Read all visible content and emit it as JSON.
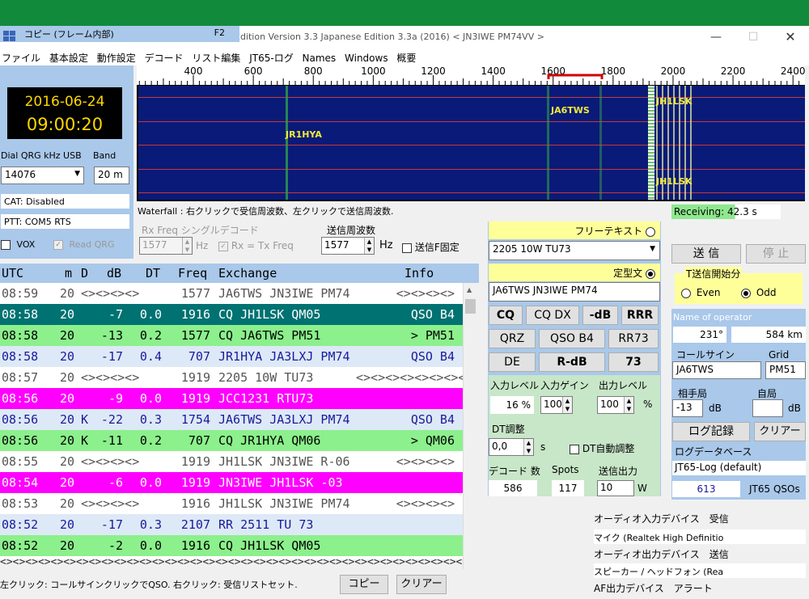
{
  "window": {
    "title": "< JN3IWE PM74VV >",
    "title_prefix": "Edition Version 3.3 Japanese Edition 3.3a (2016)",
    "tooltip_text": "コピー (フレーム内部)",
    "tooltip_key": "F2"
  },
  "menu": [
    "ファイル",
    "基本設定",
    "動作設定",
    "デコード",
    "リスト編集",
    "JT65-ログ",
    "Names",
    "Windows",
    "概要"
  ],
  "clock": {
    "date": "2016-06-24",
    "time": "09:00:20"
  },
  "dial": {
    "label": "Dial QRG kHz USB",
    "value": "14076",
    "band_label": "Band",
    "band_value": "20 m"
  },
  "cat_status": "CAT: Disabled",
  "ptt_status": "PTT: COM5 RTS",
  "vox_label": "VOX",
  "read_qrg_label": "Read QRG",
  "waterfall": {
    "ticks": [
      "400",
      "600",
      "800",
      "1000",
      "1200",
      "1400",
      "1600",
      "1800",
      "2000",
      "2200",
      "2400"
    ],
    "labels": [
      "JA6TWS",
      "JR1HYA",
      "JH1LSK",
      "JH1LSK"
    ],
    "note": "Waterfall : 右クリックで受信周波数、左クリックで送信周波数.",
    "receiving": "Receiving: 42.3 s"
  },
  "rx_single": {
    "label": "Rx Freq シングルデコード",
    "value": "1577",
    "unit": "Hz",
    "rx_eq_tx": "Rx = Tx Freq"
  },
  "tx_freq": {
    "label": "送信周波数",
    "value": "1577",
    "unit": "Hz",
    "fix_label": "送信F固定"
  },
  "decode_header": {
    "utc": "UTC",
    "m": "m",
    "d": "D",
    "db": "dB",
    "dt": "DT",
    "freq": "Freq",
    "exchange": "Exchange",
    "info": "Info"
  },
  "decodes": [
    {
      "utc": "08:59",
      "m": "20",
      "d": "",
      "db": "<><><><>",
      "dt": "",
      "freq": "1577",
      "exchange": "JA6TWS JN3IWE PM74",
      "info": "<><><><>",
      "bg": "#ffffff",
      "fg": "#555555"
    },
    {
      "utc": "08:58",
      "m": "20",
      "d": "",
      "db": "-7",
      "dt": "0.0",
      "freq": "1916",
      "exchange": "CQ JH1LSK QM05",
      "info": "QSO B4",
      "bg": "#007272",
      "fg": "#ffffff"
    },
    {
      "utc": "08:58",
      "m": "20",
      "d": "",
      "db": "-13",
      "dt": "0.2",
      "freq": "1577",
      "exchange": "CQ JA6TWS PM51",
      "info": "> PM51",
      "bg": "#8cf08c",
      "fg": "#000000"
    },
    {
      "utc": "08:58",
      "m": "20",
      "d": "",
      "db": "-17",
      "dt": "0.4",
      "freq": "707",
      "exchange": "JR1HYA JA3LXJ PM74",
      "info": "QSO B4",
      "bg": "#dde9f6",
      "fg": "#1a1a9a"
    },
    {
      "utc": "08:57",
      "m": "20",
      "d": "",
      "db": "<><><><>",
      "dt": "",
      "freq": "1919",
      "exchange": "2205 10W TU73",
      "info": "<><><><><><><><>",
      "bg": "#ffffff",
      "fg": "#555555"
    },
    {
      "utc": "08:56",
      "m": "20",
      "d": "",
      "db": "-9",
      "dt": "0.0",
      "freq": "1919",
      "exchange": "JCC1231 RTU73",
      "info": "",
      "bg": "#ff00ff",
      "fg": "#ffffff"
    },
    {
      "utc": "08:56",
      "m": "20",
      "d": "K",
      "db": "-22",
      "dt": "0.3",
      "freq": "1754",
      "exchange": "JA6TWS JA3LXJ PM74",
      "info": "QSO B4",
      "bg": "#dde9f6",
      "fg": "#1a1a9a"
    },
    {
      "utc": "08:56",
      "m": "20",
      "d": "K",
      "db": "-11",
      "dt": "0.2",
      "freq": "707",
      "exchange": "CQ JR1HYA QM06",
      "info": "> QM06",
      "bg": "#8cf08c",
      "fg": "#000000"
    },
    {
      "utc": "08:55",
      "m": "20",
      "d": "",
      "db": "<><><><>",
      "dt": "",
      "freq": "1919",
      "exchange": "JH1LSK JN3IWE R-06",
      "info": "<><><><>",
      "bg": "#ffffff",
      "fg": "#555555"
    },
    {
      "utc": "08:54",
      "m": "20",
      "d": "",
      "db": "-6",
      "dt": "0.0",
      "freq": "1919",
      "exchange": "JN3IWE JH1LSK -03",
      "info": "",
      "bg": "#ff00ff",
      "fg": "#ffffff"
    },
    {
      "utc": "08:53",
      "m": "20",
      "d": "",
      "db": "<><><><>",
      "dt": "",
      "freq": "1916",
      "exchange": "JH1LSK JN3IWE PM74",
      "info": "<><><><>",
      "bg": "#ffffff",
      "fg": "#555555"
    },
    {
      "utc": "08:52",
      "m": "20",
      "d": "",
      "db": "-17",
      "dt": "0.3",
      "freq": "2107",
      "exchange": "RR 2511 TU 73",
      "info": "",
      "bg": "#dde9f6",
      "fg": "#1a1a9a"
    },
    {
      "utc": "08:52",
      "m": "20",
      "d": "",
      "db": "-2",
      "dt": "0.0",
      "freq": "1916",
      "exchange": "CQ JH1LSK QM05",
      "info": "",
      "bg": "#8cf08c",
      "fg": "#000000"
    }
  ],
  "hscroll_text": "<><><><><><><><><><><><><><><><><><><><><><><><><><><><><><><><><><><><><><><><>",
  "status_hint": "左クリック: コールサインクリックでQSO. 右クリック: 受信リストセット.",
  "copy_button": "コピー",
  "clear_button": "クリアー",
  "macro": {
    "free_text_label": "フリーテキスト",
    "free_text_value": "2205 10W TU73",
    "fixed_label": "定型文",
    "fixed_value": "JA6TWS JN3IWE PM74",
    "buttons": [
      "CQ",
      "CQ DX",
      "-dB",
      "RRR",
      "QRZ",
      "QSO B4",
      "RR73",
      "DE",
      "R-dB",
      "73"
    ],
    "in_level_label": "入力レベル",
    "in_level_value": "16 %",
    "in_gain_label": "入力ゲイン",
    "in_gain_value": "100",
    "out_level_label": "出力レベル",
    "out_level_value": "100",
    "out_unit": "%",
    "dt_adj_label": "DT調整",
    "dt_value": "0,0",
    "dt_unit": "s",
    "dt_auto_label": "DT自動調整",
    "decode_count_label": "デコード 数",
    "decode_count": "586",
    "spots_label": "Spots",
    "spots": "117",
    "tx_power_label": "送信出力",
    "tx_power": "10",
    "tx_power_unit": "W"
  },
  "tx": {
    "send_button": "送 信",
    "stop_button": "停 止",
    "start_label": "T送信開始分",
    "even_label": "Even",
    "odd_label": "Odd"
  },
  "operator": {
    "name_label": "Name of operator",
    "bearing": "231°",
    "distance": "584 km",
    "callsign_label": "コールサイン",
    "grid_label": "Grid",
    "callsign": "JA6TWS",
    "grid": "PM51",
    "their_label": "相手局",
    "their_db": "-13",
    "own_label": "自局",
    "db_unit": "dB",
    "log_button": "ログ記録",
    "clear_button": "クリアー",
    "logdb_label": "ログデータベース",
    "logdb_value": "JT65-Log (default)",
    "qso_count": "613",
    "qso_label": "JT65 QSOs"
  },
  "devices": {
    "audio_in_label": "オーディオ入力デバイス　受信",
    "audio_in_value": "マイク (Realtek High Definitio",
    "audio_out_label": "オーディオ出力デバイス　送信",
    "audio_out_value": "スピーカー / ヘッドフォン (Rea",
    "af_out_label": "AF出力デバイス　アラート"
  }
}
